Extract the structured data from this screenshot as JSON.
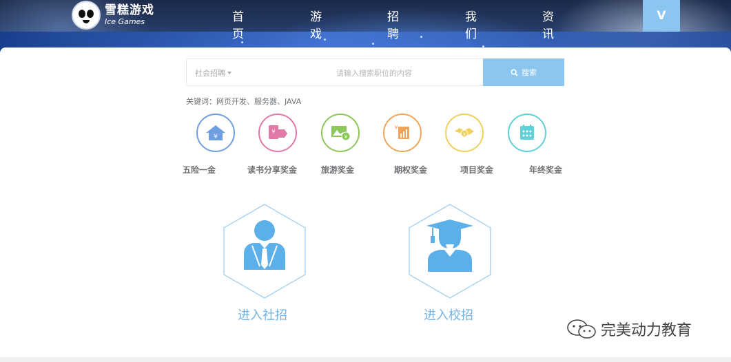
{
  "header": {
    "logo_cn": "雪糕游戏",
    "logo_en": "Ice Games",
    "nav": [
      "首页",
      "游戏",
      "招聘",
      "我们",
      "资讯"
    ],
    "user_initial": "V"
  },
  "search": {
    "category": "社会招聘",
    "placeholder": "请输入搜索职位的内容",
    "button": "搜索"
  },
  "keywords": "关键词：网页开发、服务器、JAVA",
  "benefits": [
    {
      "label": "五险一金",
      "icon": "house-yen-icon",
      "color": "#6f9fe0"
    },
    {
      "label": "读书分享奖金",
      "icon": "book-share-icon",
      "color": "#e07aa8"
    },
    {
      "label": "旅游奖金",
      "icon": "travel-photo-icon",
      "color": "#8cc75a"
    },
    {
      "label": "期权奖金",
      "icon": "stock-chart-icon",
      "color": "#f0a45a"
    },
    {
      "label": "项目奖金",
      "icon": "handshake-icon",
      "color": "#f0cf5a"
    },
    {
      "label": "年终奖金",
      "icon": "calendar-icon",
      "color": "#5fd0d8"
    }
  ],
  "entries": [
    {
      "label": "进入社招",
      "icon": "business-person-icon"
    },
    {
      "label": "进入校招",
      "icon": "graduate-icon"
    }
  ],
  "watermark": "完美动力教育",
  "colors": {
    "accent": "#8cc6ee",
    "link": "#71b3e3",
    "hex_border": "#a8d3f2"
  }
}
